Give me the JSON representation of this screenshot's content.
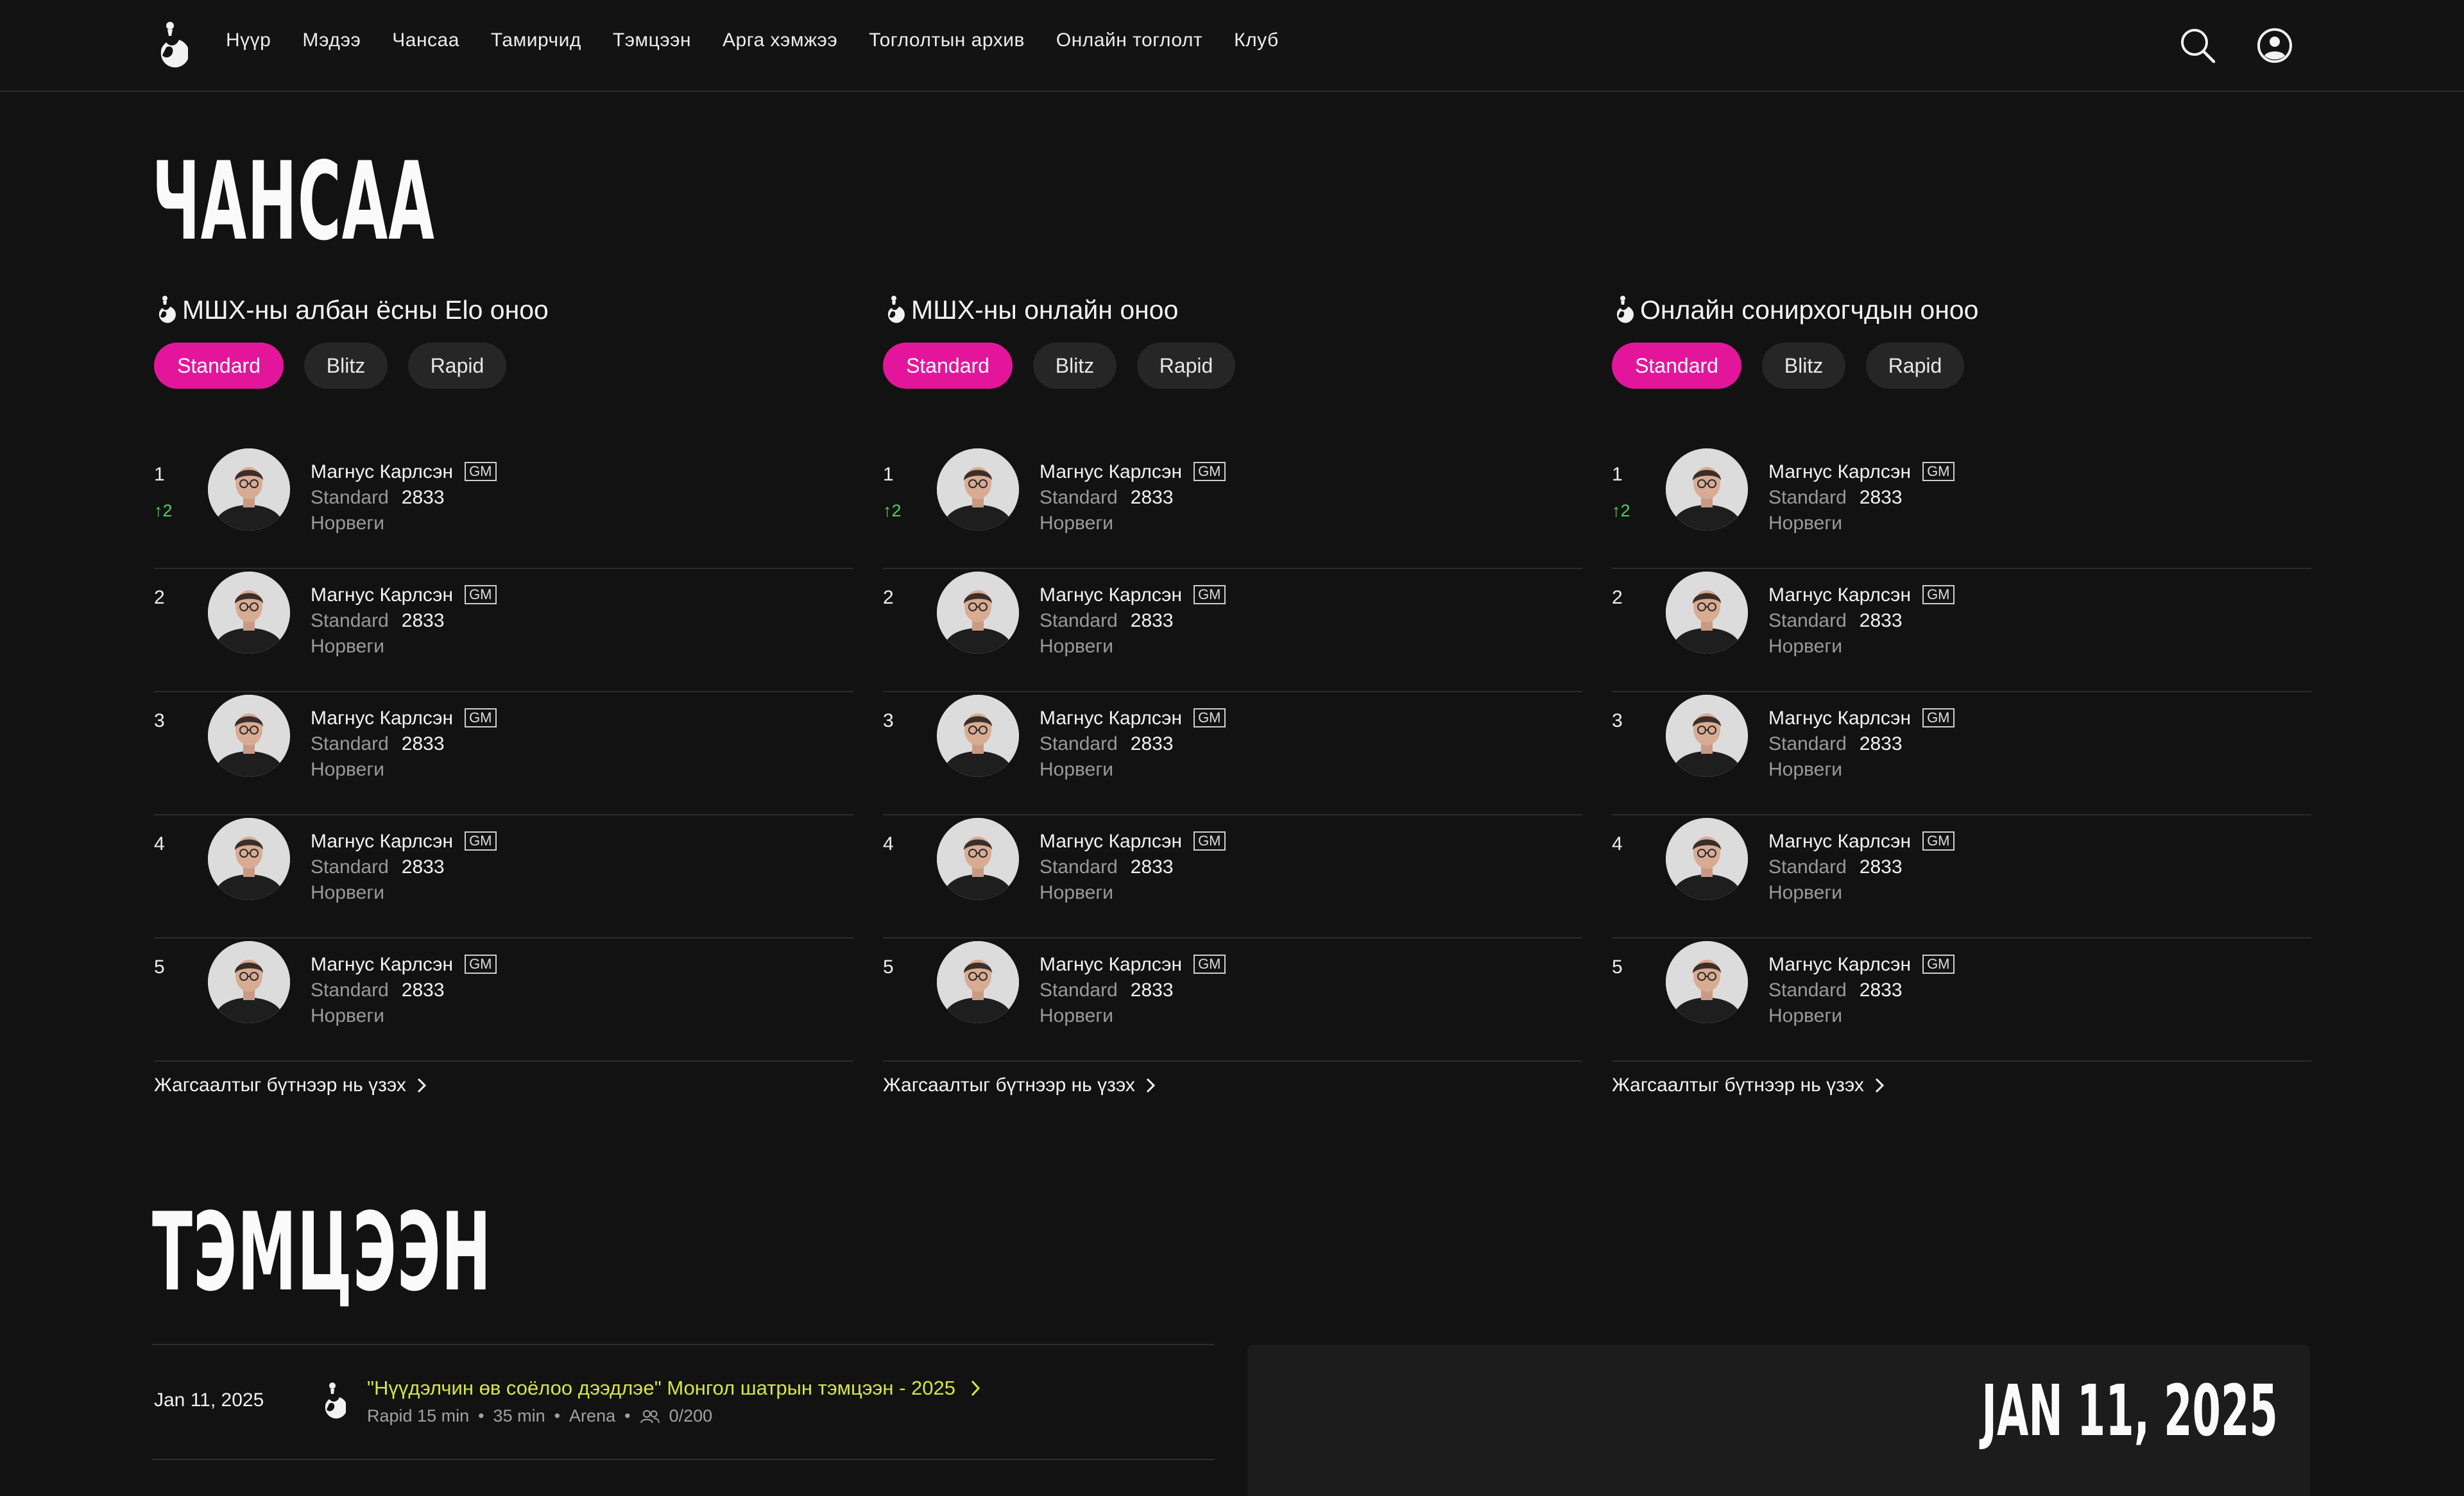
{
  "nav": {
    "items": [
      "Нүүр",
      "Мэдээ",
      "Чансаа",
      "Тамирчид",
      "Тэмцээн",
      "Арга хэмжээ",
      "Тоглолтын архив",
      "Онлайн тоглолт",
      "Клуб"
    ]
  },
  "header_icons": [
    "search-icon",
    "user-circle-icon"
  ],
  "colors": {
    "accent": "#e3169b",
    "up": "#4fd05c",
    "link": "#d7e63f",
    "background": "#121212"
  },
  "ranking": {
    "title": "ЧАНСАА",
    "view_all": "Жагсаалтыг бүтнээр нь үзэх",
    "columns": [
      {
        "title": "МШХ-ны албан ёсны Elo оноо",
        "tabs": [
          "Standard",
          "Blitz",
          "Rapid"
        ],
        "active_tab": "Standard",
        "rows": [
          {
            "rank": "1",
            "delta": "↑2",
            "name": "Магнус Карлсэн",
            "title": "GM",
            "format": "Standard",
            "rating": "2833",
            "country": "Норвеги"
          },
          {
            "rank": "2",
            "delta": "",
            "name": "Магнус Карлсэн",
            "title": "GM",
            "format": "Standard",
            "rating": "2833",
            "country": "Норвеги"
          },
          {
            "rank": "3",
            "delta": "",
            "name": "Магнус Карлсэн",
            "title": "GM",
            "format": "Standard",
            "rating": "2833",
            "country": "Норвеги"
          },
          {
            "rank": "4",
            "delta": "",
            "name": "Магнус Карлсэн",
            "title": "GM",
            "format": "Standard",
            "rating": "2833",
            "country": "Норвеги"
          },
          {
            "rank": "5",
            "delta": "",
            "name": "Магнус Карлсэн",
            "title": "GM",
            "format": "Standard",
            "rating": "2833",
            "country": "Норвеги"
          }
        ]
      },
      {
        "title": "МШХ-ны онлайн оноо",
        "tabs": [
          "Standard",
          "Blitz",
          "Rapid"
        ],
        "active_tab": "Standard",
        "rows": [
          {
            "rank": "1",
            "delta": "↑2",
            "name": "Магнус Карлсэн",
            "title": "GM",
            "format": "Standard",
            "rating": "2833",
            "country": "Норвеги"
          },
          {
            "rank": "2",
            "delta": "",
            "name": "Магнус Карлсэн",
            "title": "GM",
            "format": "Standard",
            "rating": "2833",
            "country": "Норвеги"
          },
          {
            "rank": "3",
            "delta": "",
            "name": "Магнус Карлсэн",
            "title": "GM",
            "format": "Standard",
            "rating": "2833",
            "country": "Норвеги"
          },
          {
            "rank": "4",
            "delta": "",
            "name": "Магнус Карлсэн",
            "title": "GM",
            "format": "Standard",
            "rating": "2833",
            "country": "Норвеги"
          },
          {
            "rank": "5",
            "delta": "",
            "name": "Магнус Карлсэн",
            "title": "GM",
            "format": "Standard",
            "rating": "2833",
            "country": "Норвеги"
          }
        ]
      },
      {
        "title": "Онлайн сонирхогчдын оноо",
        "tabs": [
          "Standard",
          "Blitz",
          "Rapid"
        ],
        "active_tab": "Standard",
        "rows": [
          {
            "rank": "1",
            "delta": "↑2",
            "name": "Магнус Карлсэн",
            "title": "GM",
            "format": "Standard",
            "rating": "2833",
            "country": "Норвеги"
          },
          {
            "rank": "2",
            "delta": "",
            "name": "Магнус Карлсэн",
            "title": "GM",
            "format": "Standard",
            "rating": "2833",
            "country": "Норвеги"
          },
          {
            "rank": "3",
            "delta": "",
            "name": "Магнус Карлсэн",
            "title": "GM",
            "format": "Standard",
            "rating": "2833",
            "country": "Норвеги"
          },
          {
            "rank": "4",
            "delta": "",
            "name": "Магнус Карлсэн",
            "title": "GM",
            "format": "Standard",
            "rating": "2833",
            "country": "Норвеги"
          },
          {
            "rank": "5",
            "delta": "",
            "name": "Магнус Карлсэн",
            "title": "GM",
            "format": "Standard",
            "rating": "2833",
            "country": "Норвеги"
          }
        ]
      }
    ]
  },
  "tournaments": {
    "title": "ТЭМЦЭЭН",
    "items": [
      {
        "date": "Jan 11, 2025",
        "name": "\"Нүүдэлчин өв соёлоо дээдлэе\" Монгол шатрын тэмцээн - 2025",
        "meta": [
          "Rapid 15 min",
          "35 min",
          "Arena",
          "0/200"
        ]
      }
    ],
    "feature_date": "JAN 11, 2025"
  }
}
